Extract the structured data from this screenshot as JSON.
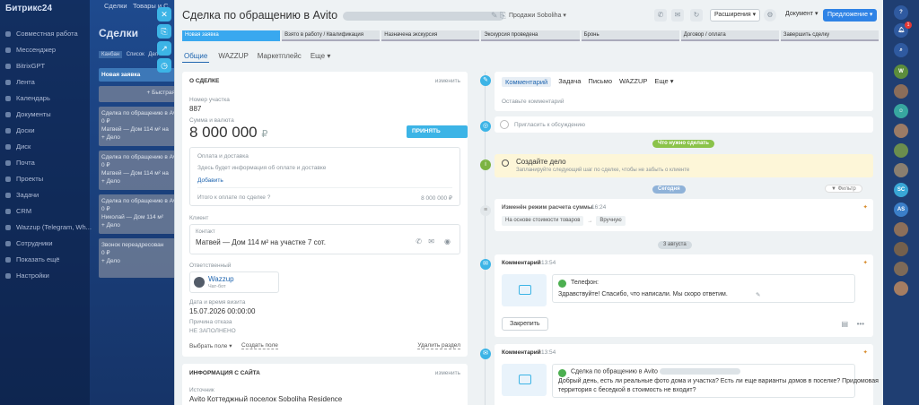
{
  "bg": {
    "app_name": "Битрикс24",
    "top_tabs": [
      "Сделки",
      "Товары и С"
    ],
    "page_title": "Сделки",
    "view_tabs": [
      "Канбан",
      "Список",
      "Дел"
    ],
    "menu": [
      "Совместная работа",
      "Мессенджер",
      "BitrixGPT",
      "Лента",
      "Календарь",
      "Документы",
      "Доски",
      "Диск",
      "Почта",
      "Проекты",
      "Задачи",
      "CRM",
      "Wazzup (Telegram, Wh...",
      "Сотрудники",
      "Показать ещё",
      "Настройки"
    ],
    "kanban_head": "Новая заявка",
    "kanban_add": "+ Быстрая",
    "cards": [
      {
        "title": "Сделка по обращению в Avito",
        "sum": "0 ₽",
        "contact": "Матвей — Дом 114 м² на",
        "note": "+ Дело"
      },
      {
        "title": "Сделка по обращению в Avito",
        "sum": "0 ₽",
        "contact": "Матвей — Дом 114 м² на",
        "note": "+ Дело"
      },
      {
        "title": "Сделка по обращению в Avito",
        "sum": "0 ₽",
        "contact": "Николай — Дом 114 м²",
        "note": "+ Дело"
      },
      {
        "title": "Звонок переадресован",
        "sum": "0 ₽",
        "contact": "",
        "note": "+ Дело"
      }
    ]
  },
  "header": {
    "title": "Сделка по обращению в Avito",
    "funnel": "Продажи Soboliha",
    "extensions": "Расширения",
    "document": "Документ",
    "offer": "Предложение"
  },
  "stages": [
    "Новая заявка",
    "Взято в работу / Квалификация",
    "Назначена экскурсия",
    "Экскурсия проведена",
    "Бронь",
    "Договор / оплата",
    "Завершить сделку"
  ],
  "tabs": [
    "Общие",
    "WAZZUP",
    "Маркетплейс",
    "Еще"
  ],
  "about": {
    "title": "О СДЕЛКЕ",
    "edit": "изменить",
    "plot_label": "Номер участка",
    "plot_value": "887",
    "sum_label": "Сумма и валюта",
    "sum_value": "8 000 000",
    "currency": "₽",
    "pay_button": "ПРИНЯТЬ ОПЛАТУ",
    "payment_title": "Оплата и доставка",
    "payment_info": "Здесь будет информация об оплате и доставке",
    "payment_add": "Добавить",
    "total_label": "Итого к оплате по сделке",
    "total_value": "8 000 000 ₽",
    "client_label": "Клиент",
    "contact_label": "Контакт",
    "contact_value": "Матвей — Дом 114 м² на участке 7 сот.",
    "responsible_label": "Ответственный",
    "responsible_name": "Wazzup",
    "responsible_role": "Чат-бот",
    "date_label": "Дата и время визита",
    "date_value": "15.07.2026 00:00:00",
    "reason_label": "Причина отказа",
    "reason_value": "НЕ ЗАПОЛНЕНО",
    "choose_field": "Выбрать поле",
    "create_field": "Создать поле",
    "delete_section": "Удалить раздел"
  },
  "site": {
    "title": "ИНФОРМАЦИЯ С САЙТА",
    "edit": "изменить",
    "source_label": "Источник",
    "source_value": "Avito Коттеджный поселок Soboliha Residence"
  },
  "timeline": {
    "editor_tabs": [
      "Комментарий",
      "Задача",
      "Письмо",
      "WAZZUP",
      "Еще"
    ],
    "comment_placeholder": "Оставьте комментарий",
    "invite": "Пригласить к обсуждению",
    "todo_pill": "Что нужно сделать",
    "todo_title": "Создайте дело",
    "todo_hint": "Запланируйте следующий шаг по сделке, чтобы не забыть о клиенте",
    "today_pill": "Сегодня",
    "filter": "Фильтр",
    "mode_title": "Изменён режим расчета суммы",
    "mode_time": "16:24",
    "mode_from": "На основе стоимости товаров",
    "mode_to": "Вручную",
    "date_pill": "3 августа",
    "c1_title": "Комментарий",
    "c1_time": "13:54",
    "c1_channel": "Телефон:",
    "c1_text": "Здравствуйте! Спасибо, что написали. Мы скоро ответим.",
    "pin": "Закрепить",
    "c2_title": "Комментарий",
    "c2_time": "13:54",
    "c2_head": "Сделка по обращению в Avito",
    "c2_text1": "Добрый день, есть ли реальные фото дома и участка? Есть ли еще варианты домов в поселке? Придомовая",
    "c2_text2": "территория с беседкой в стоимость не входит?"
  },
  "right_strip": {
    "badge": "1",
    "initials": [
      "SC",
      "AS"
    ]
  },
  "colors": {
    "accent": "#3cb4e6",
    "stage_active": "#39a8ef",
    "offer": "#2f83e6",
    "todo_bg": "#fdf6d8"
  }
}
